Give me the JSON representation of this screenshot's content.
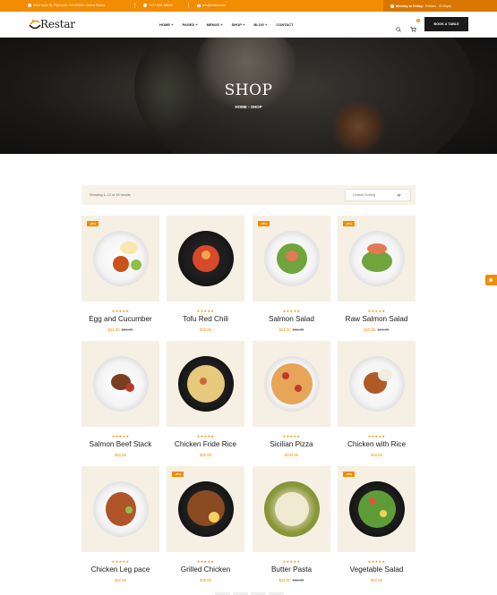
{
  "topbar": {
    "address": "9482 Main St, Plymouth, OH 95665, United States",
    "phone": "+987-628-18615",
    "email": "info@restar.com",
    "hours_label": "Monday to Friday:",
    "hours_value": "9:00am - 22:00pm"
  },
  "brand": {
    "name": "Restar",
    "accent": "#f28c00"
  },
  "nav": {
    "items": [
      {
        "label": "HOME"
      },
      {
        "label": "PAGES"
      },
      {
        "label": "MENUS"
      },
      {
        "label": "SHOP"
      },
      {
        "label": "BLOG"
      },
      {
        "label": "CONTACT"
      }
    ],
    "cart_count": "0",
    "book_button": "BOOK A TABLE"
  },
  "hero": {
    "title": "SHOP",
    "breadcrumb_home": "HOME",
    "breadcrumb_sep": "›",
    "breadcrumb_current": "SHOP"
  },
  "filter": {
    "result_text": "Showing 1–12 of 16 results",
    "sort_value": "Default Sorting"
  },
  "products": [
    {
      "name": "Egg and Cucumber",
      "rating": "★★★★★",
      "badge": "-25%",
      "price": "$24.00",
      "old_price": "$32.00"
    },
    {
      "name": "Tofu Red Chili",
      "rating": "★★★★★",
      "badge": "",
      "price": "$39.85",
      "old_price": ""
    },
    {
      "name": "Salmon Salad",
      "rating": "★★★★★",
      "badge": "-25%",
      "price": "$24.00",
      "old_price": "$32.00"
    },
    {
      "name": "Raw Salmon Salad",
      "rating": "★★★★★",
      "badge": "-25%",
      "price": "$10.85",
      "old_price": "$16.30"
    },
    {
      "name": "Salmon Beef Stack",
      "rating": "★★★★★",
      "badge": "",
      "price": "$32.85",
      "old_price": ""
    },
    {
      "name": "Chicken Fride Rice",
      "rating": "★★★★★",
      "badge": "",
      "price": "$30.85",
      "old_price": ""
    },
    {
      "name": "Sicilian Pizza",
      "rating": "★★★★★",
      "badge": "",
      "price": "$232.85",
      "old_price": ""
    },
    {
      "name": "Chicken with Rice",
      "rating": "★★★★★",
      "badge": "",
      "price": "$10.85",
      "old_price": ""
    },
    {
      "name": "Chicken Leg pace",
      "rating": "★★★★★",
      "badge": "",
      "price": "$32.85",
      "old_price": ""
    },
    {
      "name": "Grilled Chicken",
      "rating": "★★★★★",
      "badge": "-25%",
      "price": "$30.85",
      "old_price": ""
    },
    {
      "name": "Butter Pasta",
      "rating": "★★★★★",
      "badge": "",
      "price": "$24.00",
      "old_price": "$32.00"
    },
    {
      "name": "Vegetable Salad",
      "rating": "★★★★★",
      "badge": "-25%",
      "price": "$10.85",
      "old_price": ""
    }
  ]
}
